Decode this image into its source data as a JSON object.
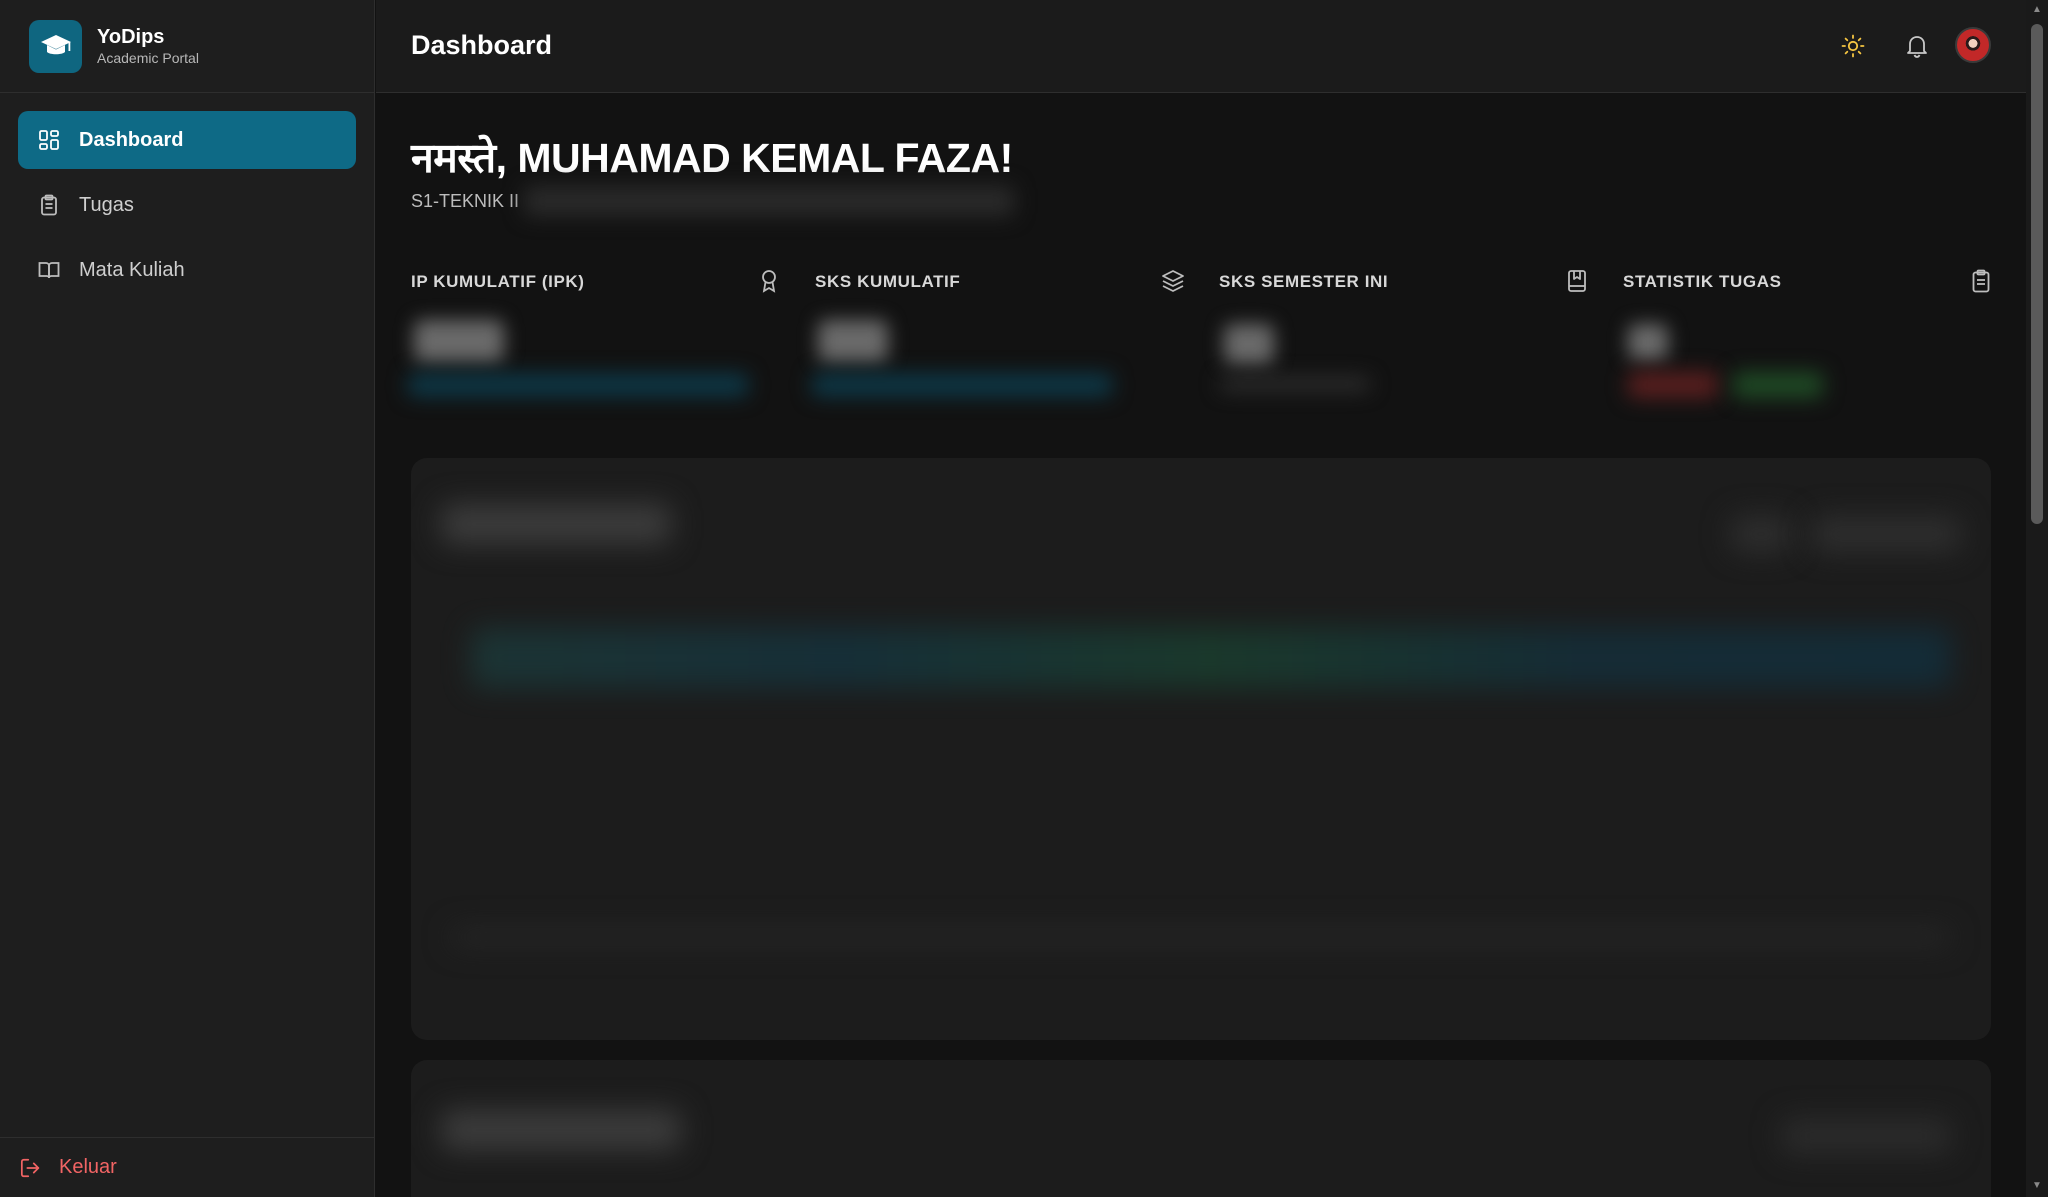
{
  "brand": {
    "name": "YoDips",
    "subtitle": "Academic Portal"
  },
  "sidebar": {
    "items": [
      {
        "label": "Dashboard",
        "icon": "grid-icon",
        "active": true
      },
      {
        "label": "Tugas",
        "icon": "clipboard-icon",
        "active": false
      },
      {
        "label": "Mata Kuliah",
        "icon": "book-open-icon",
        "active": false
      }
    ],
    "logout_label": "Keluar"
  },
  "header": {
    "title": "Dashboard",
    "icons": [
      "sun-icon",
      "bell-icon",
      "avatar"
    ]
  },
  "main": {
    "greeting": "नमस्ते, MUHAMAD KEMAL FAZA!",
    "program": "S1-TEKNIK II",
    "stats": [
      {
        "label": "IP KUMULATIF (IPK)",
        "icon": "award-icon"
      },
      {
        "label": "SKS KUMULATIF",
        "icon": "layers-icon"
      },
      {
        "label": "SKS SEMESTER INI",
        "icon": "book-bookmark-icon"
      },
      {
        "label": "STATISTIK TUGAS",
        "icon": "clipboard-icon"
      }
    ]
  },
  "colors": {
    "accent": "#0e6a86",
    "logout": "#f16464",
    "sun": "#f5c542",
    "background": "#121212",
    "sidebar": "#1e1e1e"
  }
}
